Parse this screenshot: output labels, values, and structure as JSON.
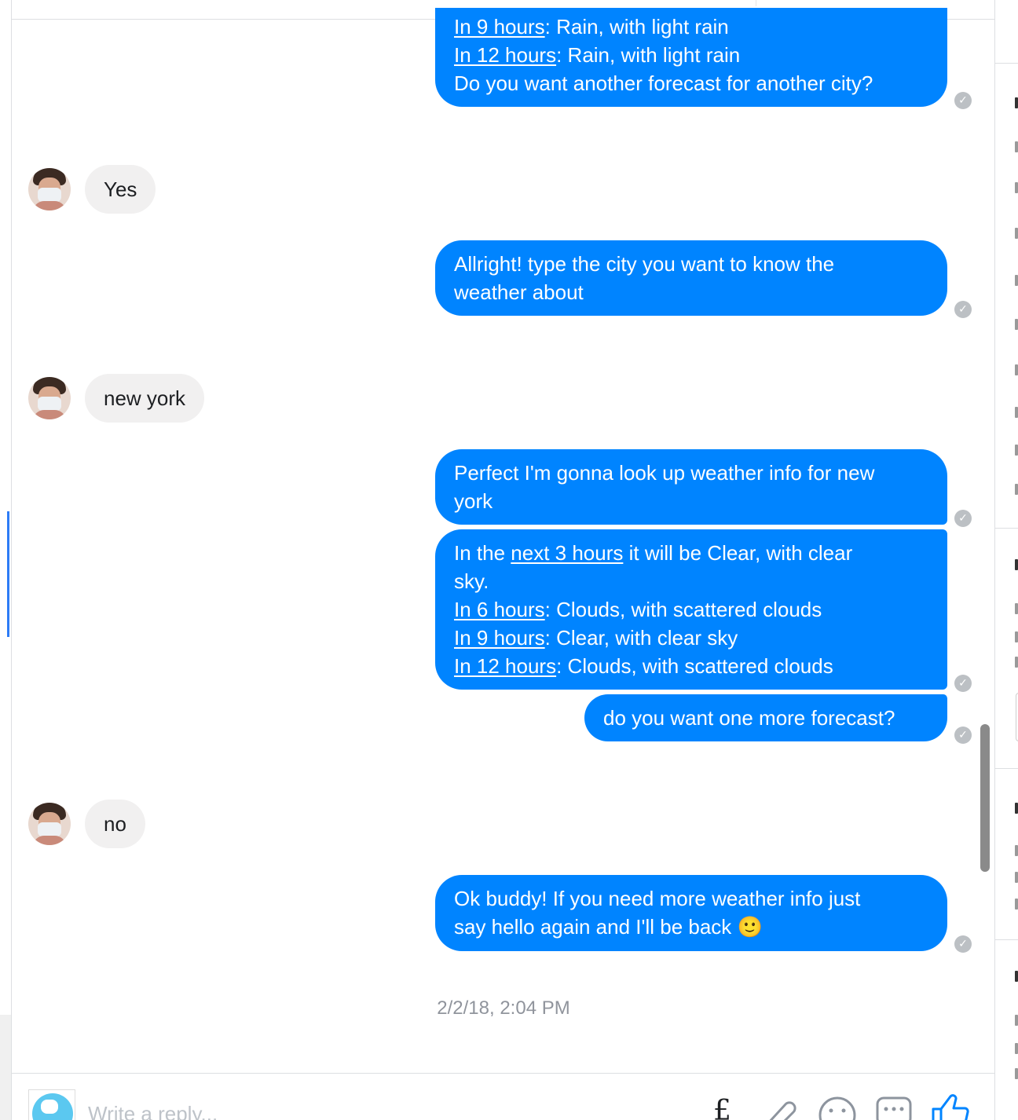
{
  "conversation": {
    "messages": [
      {
        "id": "m1",
        "direction": "outgoing",
        "lines": [
          [
            {
              "text": "In 9 hours",
              "link": true
            },
            {
              "text": ": Rain, with light rain"
            }
          ],
          [
            {
              "text": "In 12 hours",
              "link": true
            },
            {
              "text": ": Rain, with light rain"
            }
          ],
          [
            {
              "text": "Do you want another forecast for another city?"
            }
          ]
        ]
      },
      {
        "id": "m2",
        "direction": "incoming",
        "text": "Yes"
      },
      {
        "id": "m3",
        "direction": "outgoing",
        "lines": [
          [
            {
              "text": "Allright! type the city you want to know the"
            }
          ],
          [
            {
              "text": "weather about"
            }
          ]
        ]
      },
      {
        "id": "m4",
        "direction": "incoming",
        "text": "new york"
      },
      {
        "id": "m5",
        "direction": "outgoing",
        "lines": [
          [
            {
              "text": "Perfect I'm gonna look up weather info for new"
            }
          ],
          [
            {
              "text": "york"
            }
          ]
        ]
      },
      {
        "id": "m6",
        "direction": "outgoing",
        "lines": [
          [
            {
              "text": "In the "
            },
            {
              "text": "next 3 hours",
              "link": true
            },
            {
              "text": " it will be Clear, with clear"
            }
          ],
          [
            {
              "text": "sky."
            }
          ],
          [
            {
              "text": "In 6 hours",
              "link": true
            },
            {
              "text": ": Clouds, with scattered clouds"
            }
          ],
          [
            {
              "text": "In 9 hours",
              "link": true
            },
            {
              "text": ": Clear, with clear sky"
            }
          ],
          [
            {
              "text": "In 12 hours",
              "link": true
            },
            {
              "text": ": Clouds, with scattered clouds"
            }
          ]
        ]
      },
      {
        "id": "m7",
        "direction": "outgoing",
        "lines": [
          [
            {
              "text": "do you want one more forecast?"
            }
          ]
        ]
      },
      {
        "id": "m8",
        "direction": "incoming",
        "text": "no"
      },
      {
        "id": "m9",
        "direction": "outgoing",
        "lines": [
          [
            {
              "text": "Ok buddy! If you need more weather info just"
            }
          ],
          [
            {
              "text": "say hello again and I'll be back "
            },
            {
              "text": "🙂",
              "emoji": true
            }
          ]
        ]
      }
    ],
    "timestamp": "2/2/18, 2:04 PM"
  },
  "composer": {
    "placeholder": "Write a reply...",
    "tools": [
      "sticker-icon",
      "attachment-icon",
      "emoji-icon",
      "more-icon",
      "like-icon"
    ]
  },
  "colors": {
    "outgoing_bubble": "#0084ff",
    "incoming_bubble": "#f1f0f0",
    "seen_check": "#bcc0c4",
    "timestamp_text": "#90949c"
  }
}
